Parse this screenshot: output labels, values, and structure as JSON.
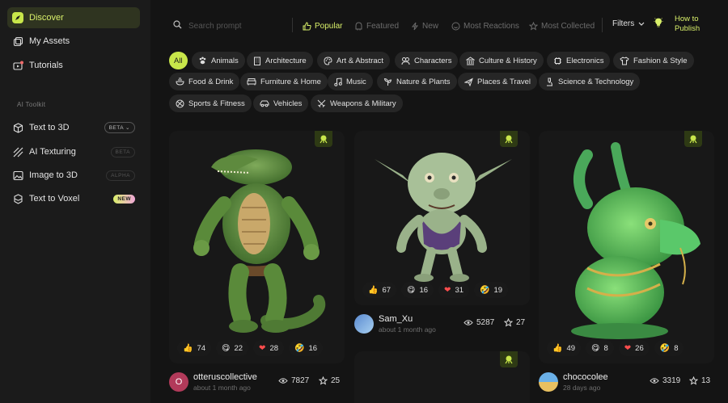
{
  "sidebar": {
    "nav": [
      {
        "label": "Discover",
        "icon": "compass-icon"
      },
      {
        "label": "My Assets",
        "icon": "assets-icon"
      },
      {
        "label": "Tutorials",
        "icon": "tutorials-icon"
      }
    ],
    "section_title": "AI Toolkit",
    "tools": [
      {
        "label": "Text to 3D",
        "badge": "BETA",
        "icon": "cube-icon"
      },
      {
        "label": "AI Texturing",
        "badge": "BETA",
        "icon": "texture-icon"
      },
      {
        "label": "Image to 3D",
        "badge": "ALPHA",
        "icon": "image-icon"
      },
      {
        "label": "Text to Voxel",
        "badge": "NEW",
        "icon": "voxel-icon"
      }
    ]
  },
  "topbar": {
    "search_placeholder": "Search prompt",
    "tabs": [
      "Popular",
      "Featured",
      "New",
      "Most Reactions",
      "Most Collected"
    ],
    "filters_label": "Filters",
    "publish_line1": "How to",
    "publish_line2": "Publish"
  },
  "categories": [
    "All",
    "Animals",
    "Architecture",
    "Art & Abstract",
    "Characters",
    "Culture & History",
    "Electronics",
    "Fashion & Style",
    "Food & Drink",
    "Furniture & Home",
    "Music",
    "Nature & Plants",
    "Places & Travel",
    "Science & Technology",
    "Sports & Fitness",
    "Vehicles",
    "Weapons & Military"
  ],
  "cards": [
    {
      "reactions": [
        "74",
        "22",
        "28",
        "16"
      ],
      "user": "otteruscollective",
      "avatar_letter": "O",
      "time": "about 1 month ago",
      "views": "7827",
      "stars": "25"
    },
    {
      "reactions": [
        "67",
        "16",
        "31",
        "19"
      ],
      "user": "Sam_Xu",
      "time": "about 1 month ago",
      "views": "5287",
      "stars": "27"
    },
    {
      "reactions": [
        "49",
        "8",
        "26",
        "8"
      ],
      "user": "chococolee",
      "time": "28 days ago",
      "views": "3319",
      "stars": "13"
    }
  ],
  "colors": {
    "accent": "#c8e64a",
    "background": "#141414",
    "sidebar": "#1b1b1b",
    "chip": "#262626"
  }
}
